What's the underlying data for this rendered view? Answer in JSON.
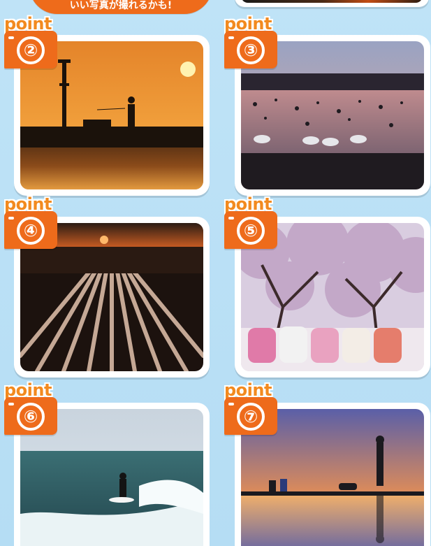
{
  "header": {
    "callout_text": "いい写真が撮れるかも!"
  },
  "points": [
    {
      "label": "point",
      "number": "②"
    },
    {
      "label": "point",
      "number": "③"
    },
    {
      "label": "point",
      "number": "④"
    },
    {
      "label": "point",
      "number": "⑤"
    },
    {
      "label": "point",
      "number": "⑥"
    },
    {
      "label": "point",
      "number": "⑦"
    }
  ],
  "colors": {
    "background": "#b9e0f5",
    "accent_orange": "#ee6b1b",
    "point_text": "#f28a1f",
    "card_border": "#ffffff"
  }
}
